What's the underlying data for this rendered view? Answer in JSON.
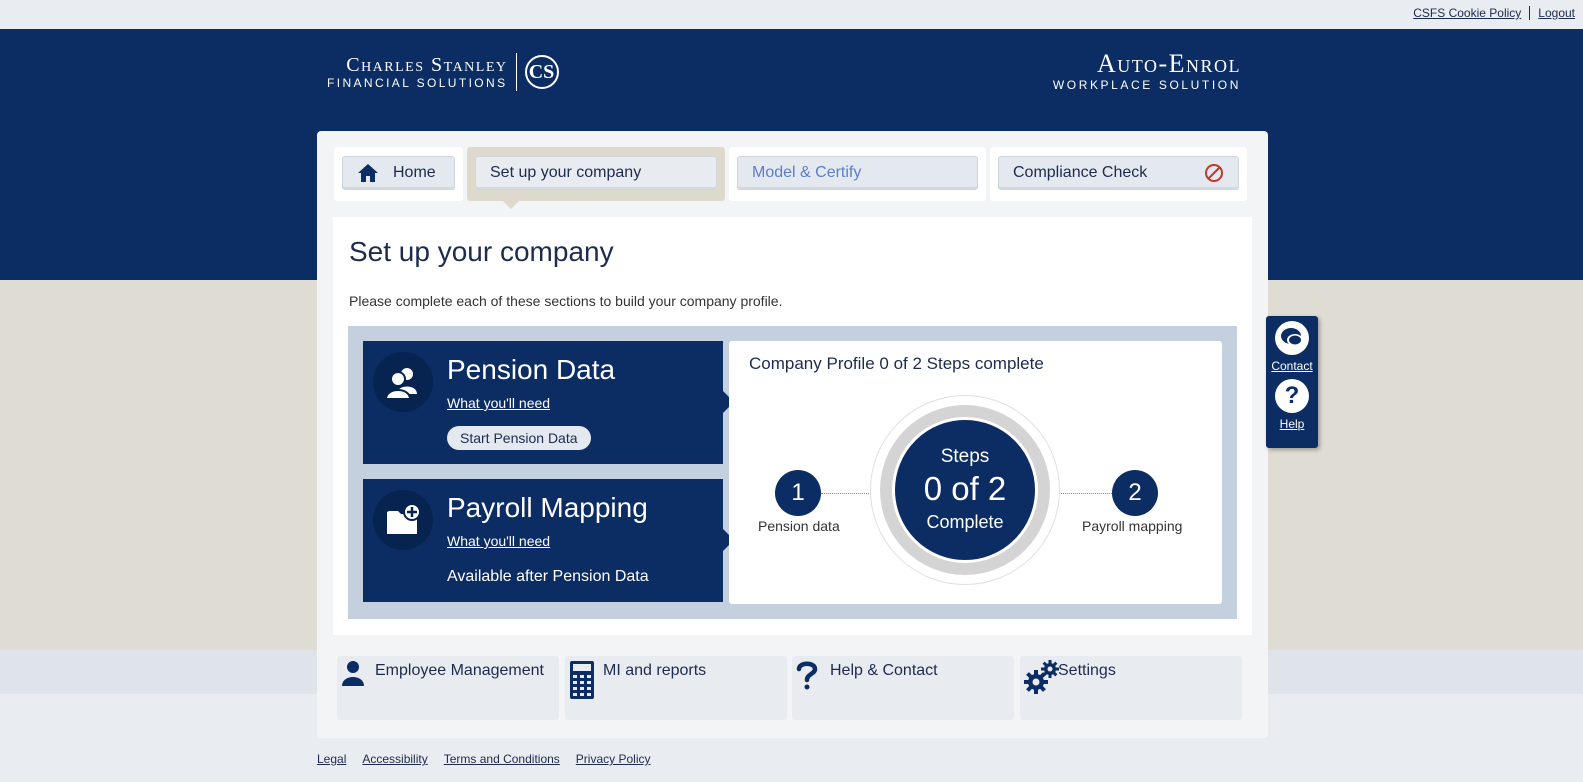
{
  "top_links": {
    "cookie": "CSFS Cookie Policy",
    "logout": "Logout"
  },
  "logo_left": {
    "line1": "Charles Stanley",
    "line2": "Financial Solutions",
    "monogram": "CS"
  },
  "logo_right": {
    "line1": "Auto-Enrol",
    "line2": "Workplace Solution"
  },
  "tabs": {
    "home": "Home",
    "setup": "Set up your company",
    "model": "Model & Certify",
    "compliance": "Compliance Check"
  },
  "main": {
    "title": "Set up your company",
    "intro": "Please complete each of these sections to build your company profile."
  },
  "cards": {
    "pension": {
      "title": "Pension Data",
      "need": "What you'll need",
      "button": "Start Pension Data"
    },
    "payroll": {
      "title": "Payroll Mapping",
      "need": "What you'll need",
      "status": "Available after Pension Data"
    }
  },
  "progress": {
    "title": "Company Profile 0 of 2 Steps complete",
    "ring_top": "Steps",
    "ring_mid": "0 of 2",
    "ring_bottom": "Complete",
    "step1_num": "1",
    "step1_label": "Pension data",
    "step2_num": "2",
    "step2_label": "Payroll mapping"
  },
  "bottom_nav": {
    "employee": "Employee Management",
    "mi": "MI and reports",
    "help": "Help & Contact",
    "settings": "Settings"
  },
  "side_widget": {
    "contact": "Contact",
    "help": "Help",
    "help_glyph": "?"
  },
  "footer": {
    "legal": "Legal",
    "accessibility": "Accessibility",
    "terms": "Terms and Conditions",
    "privacy": "Privacy Policy"
  },
  "colors": {
    "navy": "#0b2d63",
    "beige": "#dfdcd3",
    "link_blue": "#5b7fc9",
    "blocked_red": "#c0392b"
  }
}
